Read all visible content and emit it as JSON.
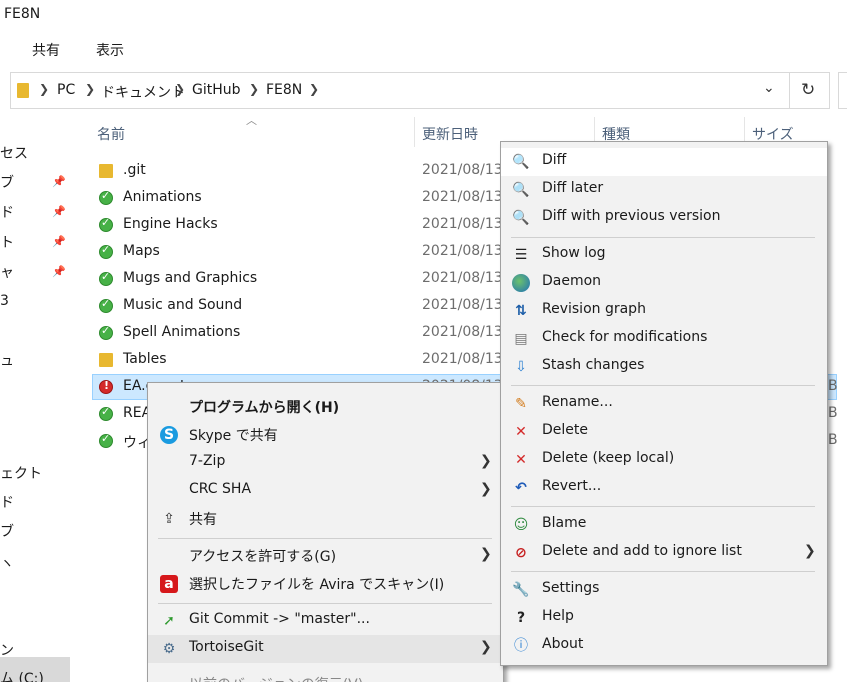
{
  "window": {
    "title": "FE8N"
  },
  "ribbon": {
    "tabs": [
      "共有",
      "表示"
    ]
  },
  "address": {
    "crumbs": [
      "PC",
      "ドキュメント",
      "GitHub",
      "FE8N"
    ],
    "dropdown_icon": "chevron-down-icon",
    "refresh_icon": "refresh-icon"
  },
  "nav": {
    "fragments": [
      "セス",
      "ブ",
      "ド",
      "ト",
      "ャ",
      "3",
      "ュ",
      "ェクト",
      "ド",
      "ブ",
      "ヽ",
      "ン",
      "ム (C:)"
    ]
  },
  "columns": [
    "名前",
    "更新日時",
    "種類",
    "サイズ"
  ],
  "files": [
    {
      "name": ".git",
      "date": "2021/08/13",
      "icon": "folder-icon"
    },
    {
      "name": "Animations",
      "date": "2021/08/13",
      "icon": "git-clean-folder-icon"
    },
    {
      "name": "Engine Hacks",
      "date": "2021/08/13",
      "icon": "git-clean-folder-icon"
    },
    {
      "name": "Maps",
      "date": "2021/08/13",
      "icon": "git-clean-folder-icon"
    },
    {
      "name": "Mugs and Graphics",
      "date": "2021/08/13",
      "icon": "git-clean-folder-icon"
    },
    {
      "name": "Music and Sound",
      "date": "2021/08/13",
      "icon": "git-clean-folder-icon"
    },
    {
      "name": "Spell Animations",
      "date": "2021/08/13",
      "icon": "git-clean-folder-icon"
    },
    {
      "name": "Tables",
      "date": "2021/08/13",
      "icon": "folder-icon"
    },
    {
      "name": "EA.event",
      "date": "2021/08/13",
      "icon": "git-conflict-file-icon",
      "size_fragment": "B"
    },
    {
      "name": "REA",
      "date": "",
      "icon": "git-clean-file-icon",
      "size_fragment": "B"
    },
    {
      "name": "ウィ",
      "date": "",
      "icon": "git-clean-file-icon",
      "size_fragment": "B"
    }
  ],
  "shell_menu": {
    "items": [
      {
        "label": "プログラムから開く(H)",
        "icon": "",
        "bold": true
      },
      {
        "label": "Skype で共有",
        "icon": "skype-icon"
      },
      {
        "label": "7-Zip",
        "icon": "",
        "submenu": true
      },
      {
        "label": "CRC SHA",
        "icon": "",
        "submenu": true
      },
      {
        "label": "共有",
        "icon": "share-icon"
      },
      {
        "label": "アクセスを許可する(G)",
        "icon": "",
        "submenu": true
      },
      {
        "label": "選択したファイルを Avira でスキャン(I)",
        "icon": "avira-icon"
      },
      {
        "label": "Git Commit -> \"master\"...",
        "icon": "git-commit-icon"
      },
      {
        "label": "TortoiseGit",
        "icon": "tortoisegit-icon",
        "submenu": true
      },
      {
        "label": "以前のバージョンの復元(V)",
        "icon": ""
      }
    ],
    "glyphs": {
      "skype": "S",
      "avira": "a",
      "share": "⇪",
      "commit": "➚",
      "tgit": "⚙",
      "arrow": "❯"
    }
  },
  "git_menu": {
    "items": [
      {
        "label": "Diff",
        "icon": "diff-icon"
      },
      {
        "label": "Diff later",
        "icon": "diff-later-icon"
      },
      {
        "label": "Diff with previous version",
        "icon": "diff-previous-icon"
      },
      {
        "label": "Show log",
        "icon": "show-log-icon"
      },
      {
        "label": "Daemon",
        "icon": "daemon-icon"
      },
      {
        "label": "Revision graph",
        "icon": "revision-graph-icon"
      },
      {
        "label": "Check for modifications",
        "icon": "check-modifications-icon"
      },
      {
        "label": "Stash changes",
        "icon": "stash-icon"
      },
      {
        "label": "Rename...",
        "icon": "rename-icon"
      },
      {
        "label": "Delete",
        "icon": "delete-icon"
      },
      {
        "label": "Delete (keep local)",
        "icon": "delete-keep-local-icon"
      },
      {
        "label": "Revert...",
        "icon": "revert-icon"
      },
      {
        "label": "Blame",
        "icon": "blame-icon"
      },
      {
        "label": "Delete and add to ignore list",
        "icon": "ignore-icon",
        "submenu": true
      },
      {
        "label": "Settings",
        "icon": "settings-icon"
      },
      {
        "label": "Help",
        "icon": "help-icon"
      },
      {
        "label": "About",
        "icon": "about-icon"
      }
    ],
    "glyphs": {
      "mag": "🔍",
      "log": "☰",
      "graph": "⇅",
      "check": "▤",
      "stash": "⇩",
      "pencil": "✎",
      "x": "✕",
      "revert": "↶",
      "blame": "☺",
      "ignore": "⊘",
      "settings": "🔧",
      "help": "?",
      "about": "ⓘ",
      "arrow": "❯"
    }
  }
}
